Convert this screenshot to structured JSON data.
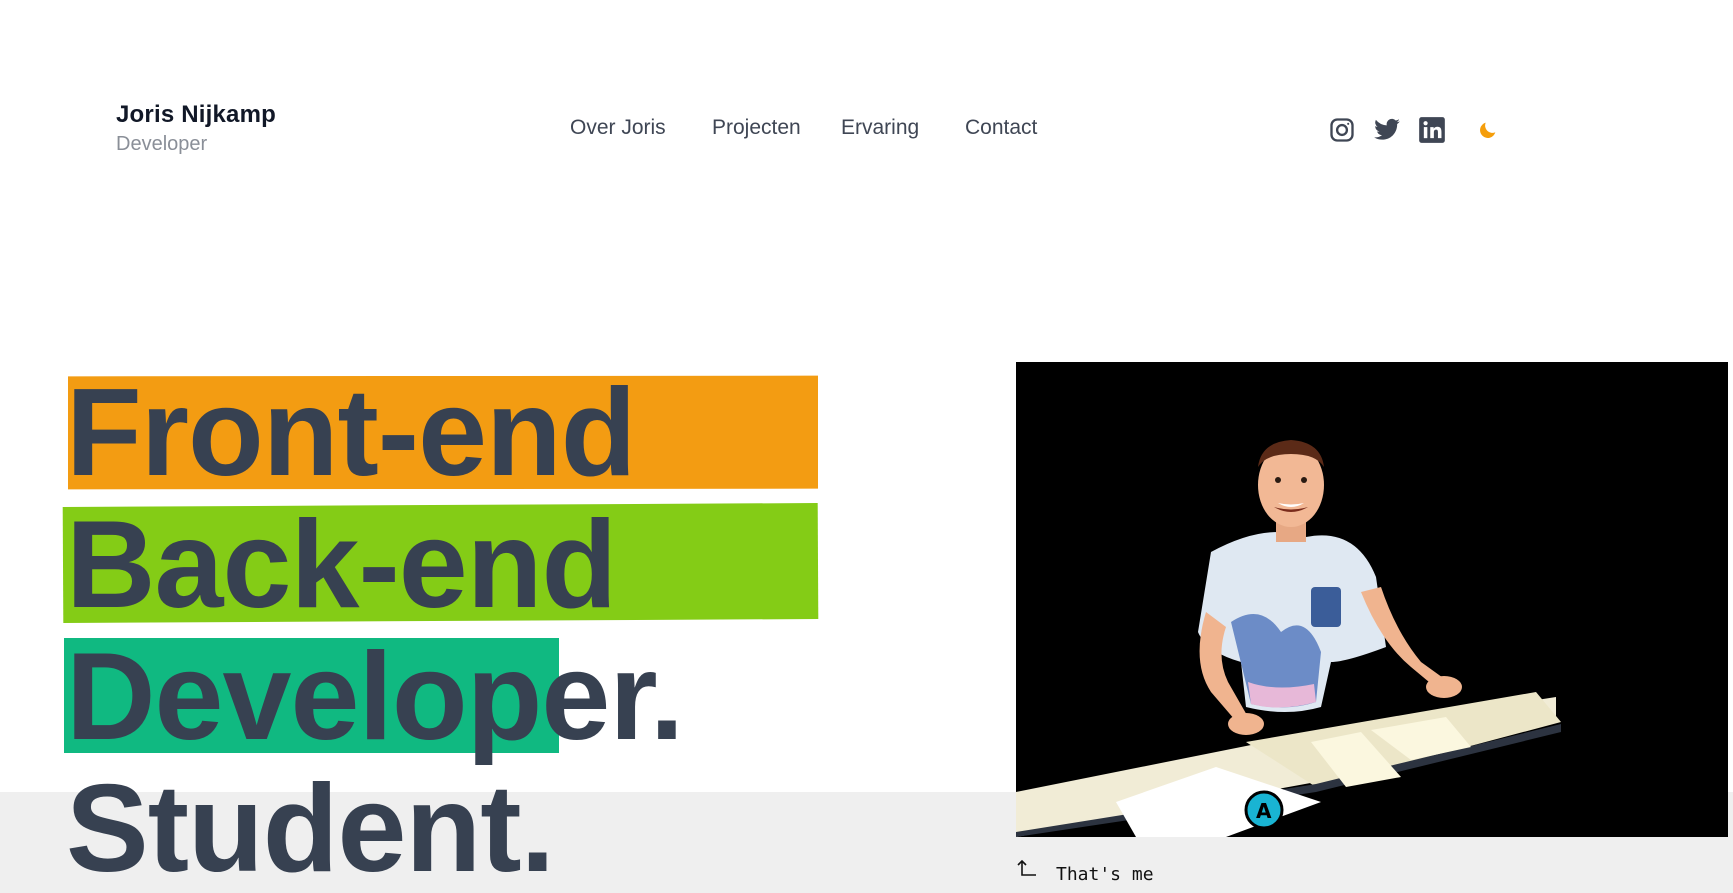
{
  "header": {
    "name": "Joris Nijkamp",
    "role": "Developer",
    "nav": [
      "Over Joris",
      "Projecten",
      "Ervaring",
      "Contact"
    ],
    "social_icons": [
      "instagram-icon",
      "twitter-icon",
      "linkedin-icon"
    ],
    "theme_icon": "moon-icon",
    "theme_color": "#f59e0b"
  },
  "hero": {
    "lines": [
      "Front-end",
      "Back-end",
      "Developer.",
      "Student."
    ],
    "highlight_colors": [
      "#f39c12",
      "#84cc16",
      "#10b981"
    ],
    "text_color": "#374151"
  },
  "photo": {
    "caption": "That's me",
    "caption_icon": "corner-up-left-arrow-icon"
  }
}
